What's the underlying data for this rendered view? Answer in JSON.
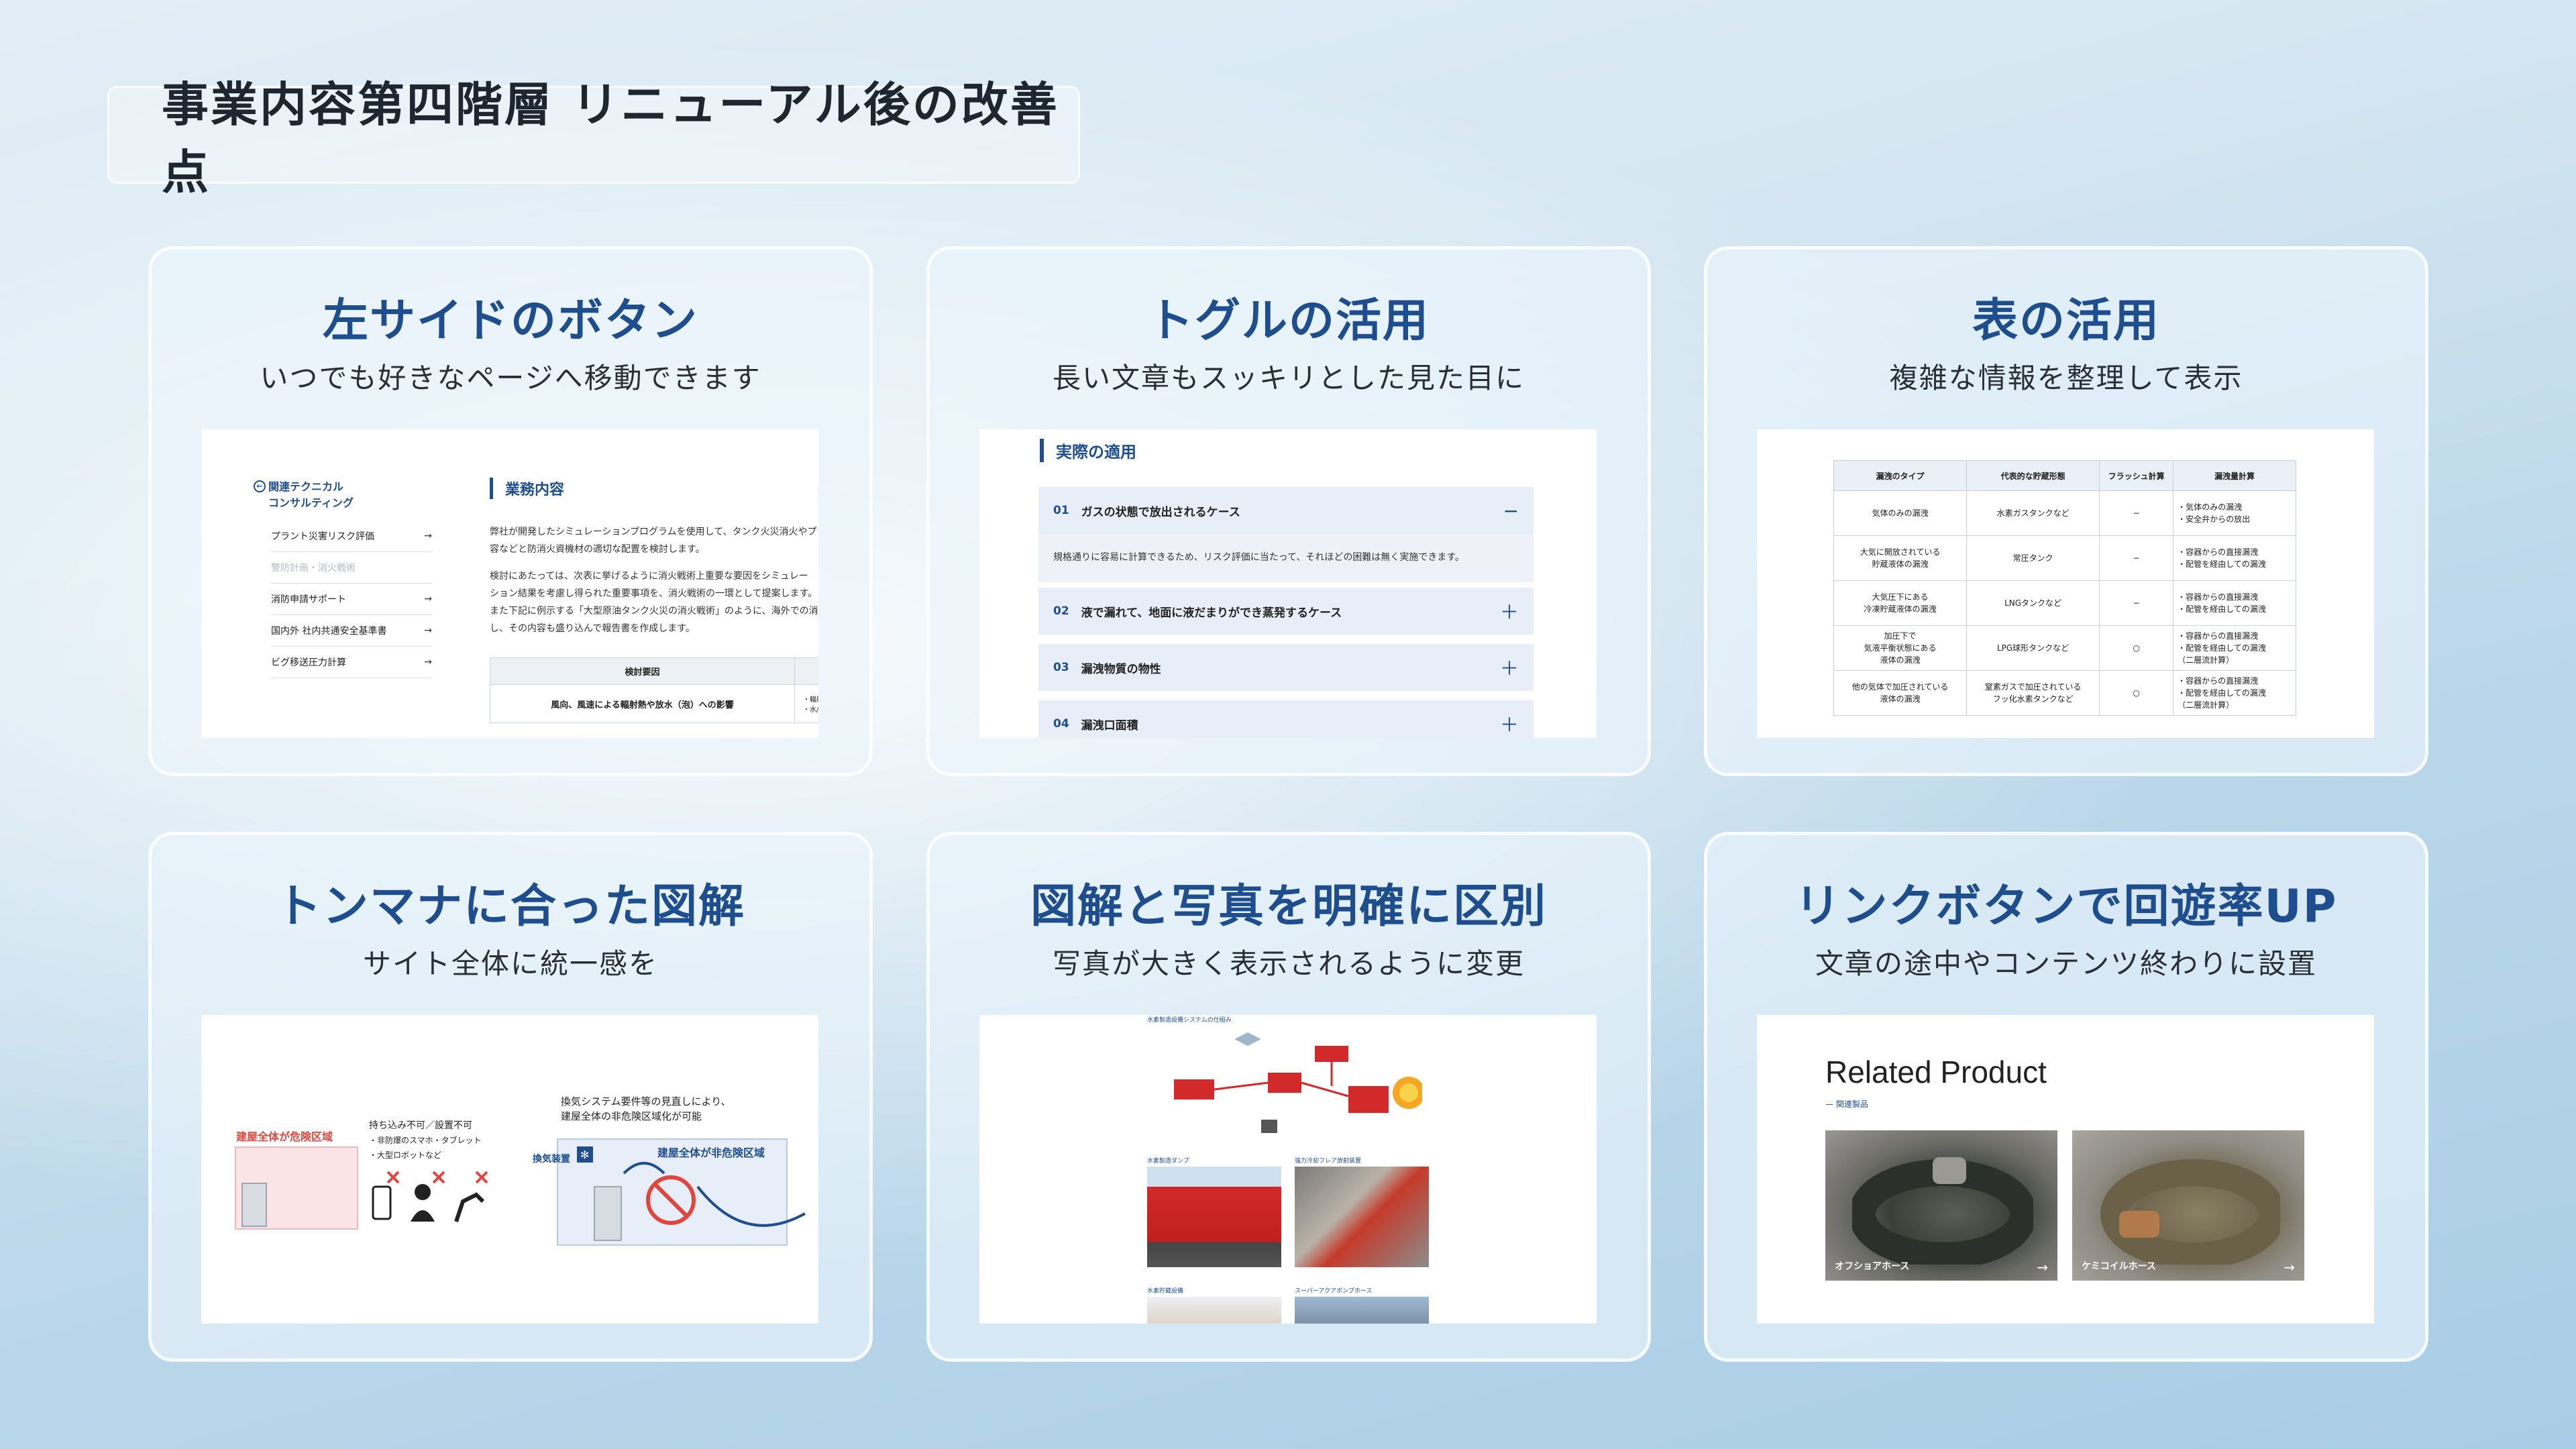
{
  "page": {
    "title": "事業内容第四階層 リニューアル後の改善点"
  },
  "cards": [
    {
      "title": "左サイドのボタン",
      "subtitle": "いつでも好きなページへ移動できます",
      "shot": {
        "sidebar_heading_1": "関連テクニカル",
        "sidebar_heading_2": "コンサルティング",
        "items": [
          "プラント災害リスク評価",
          "警防計画・消火戦術",
          "消防申請サポート",
          "国内外 社内共通安全基準書",
          "ビグ移送圧力計算"
        ],
        "main_heading": "業務内容",
        "paragraph_lines": [
          "弊社が開発したシミュレーションプログラムを使用して、タンク火災消火やプ",
          "容などと防消火資機材の適切な配置を検討します。",
          "検討にあたっては、次表に挙げるように消火戦術上重要な要因をシミュレー",
          "ション結果を考慮し得られた重要事項を、消火戦術の一環として提案します。",
          "また下記に例示する「大型原油タンク火災の消火戦術」のように、海外での消",
          "し、その内容も盛り込んで報告書を作成します。"
        ],
        "table_header": "検討要因",
        "table_row": "風向、風速による輻射熱や放水（泡）への影響",
        "table_side_1": "・輻射",
        "table_side_2": "・水/"
      }
    },
    {
      "title": "トグルの活用",
      "subtitle": "長い文章もスッキリとした見た目に",
      "shot": {
        "heading": "実際の適用",
        "rows": [
          {
            "num": "01",
            "title": "ガスの状態で放出されるケース",
            "sign": "−"
          },
          {
            "num": "02",
            "title": "液で漏れて、地面に液だまりができ蒸発するケース",
            "sign": "＋"
          },
          {
            "num": "03",
            "title": "漏洩物質の物性",
            "sign": "＋"
          },
          {
            "num": "04",
            "title": "漏洩口面積",
            "sign": "＋"
          }
        ],
        "row1_body": "規格通りに容易に計算できるため、リスク評価に当たって、それほどの困難は無く実施できます。"
      }
    },
    {
      "title": "表の活用",
      "subtitle": "複雑な情報を整理して表示",
      "shot": {
        "headers": [
          "漏洩のタイプ",
          "代表的な貯蔵形態",
          "フラッシュ計算",
          "漏洩量計算"
        ],
        "rows": [
          [
            "気体のみの漏洩",
            "水素ガスタンクなど",
            "−",
            "・気体のみの漏洩|・安全弁からの放出"
          ],
          [
            "大気に開放されている|貯蔵液体の漏洩",
            "常圧タンク",
            "−",
            "・容器からの直接漏洩|・配管を経由しての漏洩"
          ],
          [
            "大気圧下にある|冷凍貯蔵液体の漏洩",
            "LNGタンクなど",
            "−",
            "・容器からの直接漏洩|・配管を経由しての漏洩"
          ],
          [
            "加圧下で|気液平衡状態にある|液体の漏洩",
            "LPG球形タンクなど",
            "○",
            "・容器からの直接漏洩|・配管を経由しての漏洩|（二層流計算）"
          ],
          [
            "他の気体で加圧されている|液体の漏洩",
            "窒素ガスで加圧されている|フッ化水素タンクなど",
            "○",
            "・容器からの直接漏洩|・配管を経由しての漏洩|（二層流計算）"
          ]
        ]
      }
    },
    {
      "title": "トンマナに合った図解",
      "subtitle": "サイト全体に統一感を",
      "shot": {
        "left_label": "建屋全体が危険区域",
        "note_1": "持ち込み不可／設置不可",
        "note_2": "・非防爆のスマホ・タブレット",
        "note_3": "・大型ロボットなど",
        "caption_1": "換気システム要件等の見直しにより、",
        "caption_2": "建屋全体の非危険区域化が可能",
        "right_label": "建屋全体が非危険区域",
        "vent_label": "換気装置"
      }
    },
    {
      "title": "図解と写真を明確に区別",
      "subtitle": "写真が大きく表示されるように変更",
      "shot": {
        "caption_top": "水素製造設備システムの仕組み",
        "caption_1": "水素製造ダンプ",
        "caption_2": "強力冷却フレア放射装置",
        "caption_3": "水素貯蔵設備",
        "caption_4": "スーパーアクアポンプホース"
      }
    },
    {
      "title": "リンクボタンで回遊率UP",
      "subtitle": "文章の途中やコンテンツ終わりに設置",
      "shot": {
        "heading": "Related Product",
        "subheading": "— 関連製品",
        "products": [
          {
            "label": "オフショアホース",
            "arrow": "→"
          },
          {
            "label": "ケミコイルホース",
            "arrow": "→"
          }
        ]
      }
    }
  ],
  "colors": {
    "accent": "#1f4e8e",
    "danger": "#e0463d",
    "title_text": "#1e2630"
  }
}
